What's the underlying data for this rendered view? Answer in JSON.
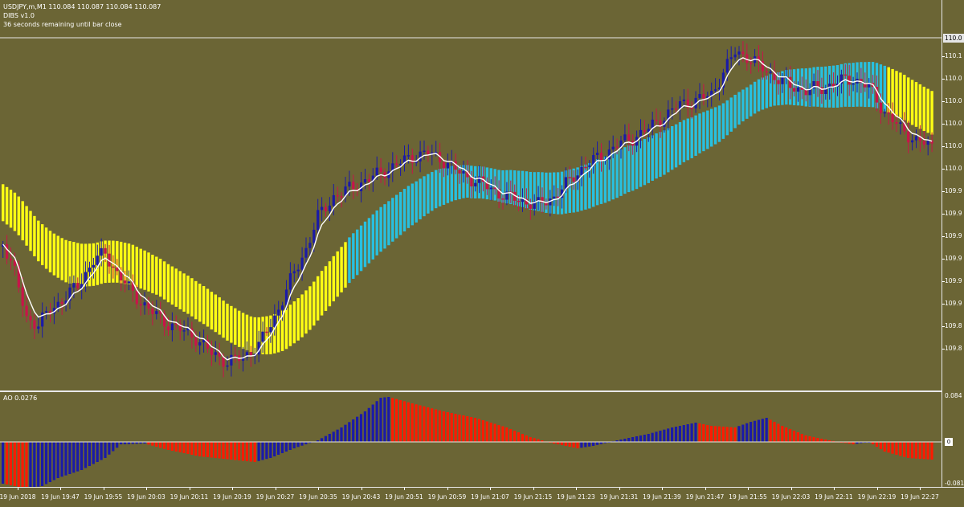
{
  "chart": {
    "symbol_header": "USDJPY,m,M1  110.084 110.087 110.084 110.087",
    "indicator_header": "DIBS v1.0",
    "timer_text": "36 seconds remaining until bar close",
    "current_price_label": "110.0",
    "price_scale_labels": [
      "110.1",
      "110.0",
      "110.0",
      "110.0",
      "110.0",
      "110.0",
      "109.9",
      "109.9",
      "109.9",
      "109.9",
      "109.9",
      "109.9",
      "109.8",
      "109.8"
    ]
  },
  "ao": {
    "title": "AO 0.0276",
    "scale_top": "0.084",
    "scale_bottom": "-0.081",
    "zero_marker": "0"
  },
  "time_axis": {
    "labels": [
      "19 Jun 2018",
      "19 Jun 19:47",
      "19 Jun 19:55",
      "19 Jun 20:03",
      "19 Jun 20:11",
      "19 Jun 20:19",
      "19 Jun 20:27",
      "19 Jun 20:35",
      "19 Jun 20:43",
      "19 Jun 20:51",
      "19 Jun 20:59",
      "19 Jun 21:07",
      "19 Jun 21:15",
      "19 Jun 21:23",
      "19 Jun 21:31",
      "19 Jun 21:39",
      "19 Jun 21:47",
      "19 Jun 21:55",
      "19 Jun 22:03",
      "19 Jun 22:11",
      "19 Jun 22:19",
      "19 Jun 22:27"
    ]
  },
  "colors": {
    "background": "#6b6535",
    "bull_candle": "#1a1aa8",
    "bear_candle": "#c8144a",
    "ma_line": "#ffffff",
    "ribbon_yellow": "#ffff14",
    "ribbon_cyan": "#28c0e0",
    "ao_up": "#1a1aa8",
    "ao_down": "#ff1a00",
    "grid_line": "#e8e8e8"
  }
}
